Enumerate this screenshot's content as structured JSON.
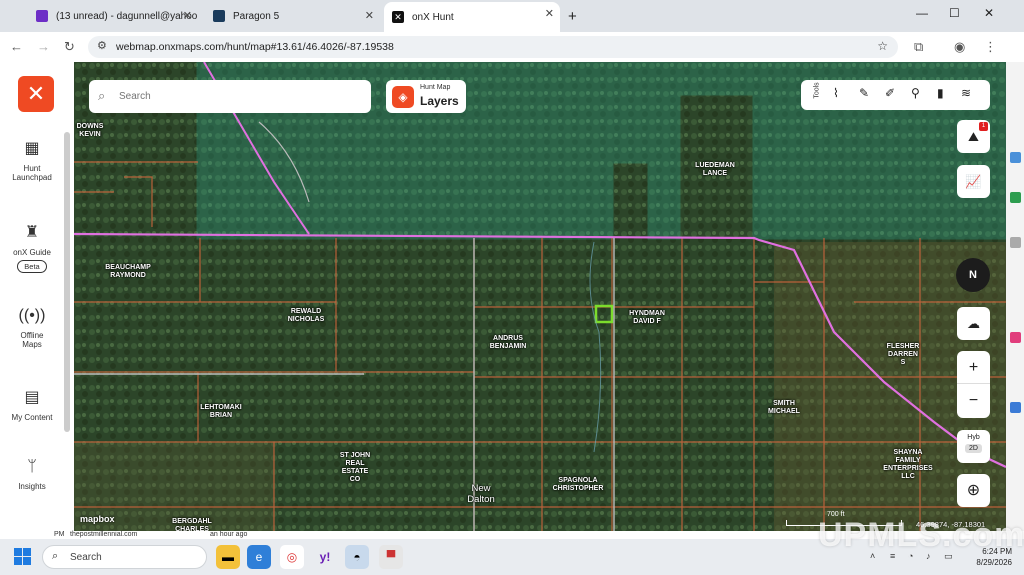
{
  "browser": {
    "tabs": [
      {
        "title": "(13 unread) - dagunnell@yahoo",
        "icon": "mail-icon",
        "color": "#6d2ec6"
      },
      {
        "title": "Paragon 5",
        "icon": "paragon-icon",
        "color": "#1a3b5c"
      },
      {
        "title": "onX Hunt",
        "icon": "onx-icon",
        "color": "#111111"
      }
    ],
    "new_tab": "+",
    "url": "webmap.onxmaps.com/hunt/map#13.61/46.4026/-87.19538"
  },
  "sidebar": {
    "logo": "✕",
    "items": [
      {
        "label": "Hunt\nLaunchpad",
        "icon": "grid-icon"
      },
      {
        "label": "onX Guide",
        "badge": "Beta",
        "icon": "guide-icon"
      },
      {
        "label": "Offline\nMaps",
        "icon": "offline-icon"
      },
      {
        "label": "My Content",
        "icon": "folder-icon"
      },
      {
        "label": "Insights",
        "icon": "deer-icon"
      }
    ]
  },
  "map": {
    "search_placeholder": "Search",
    "layers_small": "Hunt Map",
    "layers_big": "Layers",
    "tools_label": "Tools",
    "compass": "N",
    "zoom_in": "+",
    "zoom_out": "−",
    "view_hyb": "Hyb",
    "view_2d": "2D",
    "badge_count": "1",
    "mapbox": "mapbox",
    "coords": "46.39874, -87.18301",
    "scale": "700 ft",
    "colors": {
      "parcel": "#c8643c",
      "road": "#e070e0",
      "public": "#2fb39a",
      "highlight": "#7cdc2c"
    },
    "parcels": [
      {
        "owner": "DOWNS\nKEVIN"
      },
      {
        "owner": "LUEDEMAN\nLANCE"
      },
      {
        "owner": "BEAUCHAMP\nRAYMOND"
      },
      {
        "owner": "REWALD\nNICHOLAS"
      },
      {
        "owner": "ANDRUS\nBENJAMIN"
      },
      {
        "owner": "HYNDMAN\nDAVID F"
      },
      {
        "owner": "FLESHER\nDARREN\nS"
      },
      {
        "owner": "SMITH\nMICHAEL"
      },
      {
        "owner": "LEHTOMAKI\nBRIAN"
      },
      {
        "owner": "ST JOHN\nREAL\nESTATE\nCO"
      },
      {
        "owner": "SPAGNOLA\nCHRISTOPHER"
      },
      {
        "owner": "SHAYNA\nFAMILY\nENTERPRISES\nLLC"
      },
      {
        "owner": "BERGDAHL\nCHARLES"
      }
    ],
    "town": "New\nDalton"
  },
  "bottom": {
    "left": "thepostmillennial.com",
    "mid": "an hour ago",
    "pm": "PM"
  },
  "taskbar": {
    "search": "Search",
    "time": "6:24 PM",
    "date": "8/29/2026"
  },
  "watermark": "UPMLS.com"
}
